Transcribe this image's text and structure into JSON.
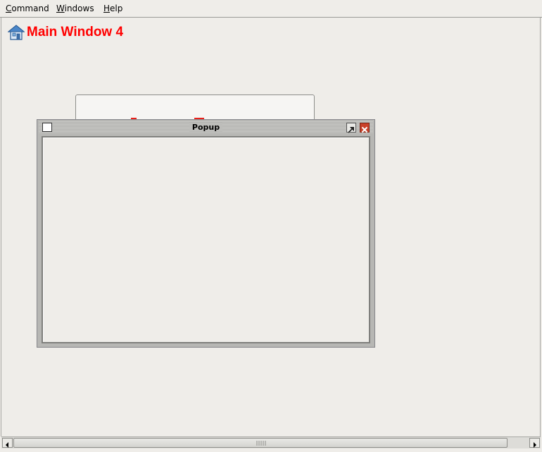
{
  "menubar": {
    "items": [
      {
        "label": "Command",
        "mnemonic": "C"
      },
      {
        "label": "Windows",
        "mnemonic": "W"
      },
      {
        "label": "Help",
        "mnemonic": "H"
      }
    ]
  },
  "main": {
    "title": "Main Window 4",
    "title_icon": "home-icon",
    "title_color": "#ff0000"
  },
  "popup": {
    "title": "Popup",
    "system_icon": "window-icon",
    "maximize_icon": "maximize-icon",
    "close_icon": "close-icon"
  },
  "scrollbar": {
    "left_icon": "arrow-left-icon",
    "right_icon": "arrow-right-icon",
    "grip_icon": "grip-icon"
  },
  "colors": {
    "background": "#efede9",
    "accent": "#ff0000",
    "close_button": "#c9412a"
  }
}
